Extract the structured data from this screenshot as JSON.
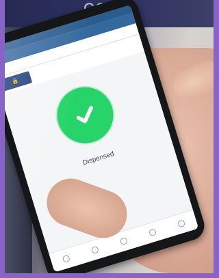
{
  "scene": {
    "background_wall_text": "CONE",
    "colors": {
      "frame_purple": "#8a63c9",
      "success_green": "#26d46a",
      "app_blue": "#34699e"
    }
  },
  "phone": {
    "status_bar": {
      "left": "",
      "right": ""
    },
    "app_bar": {
      "title": ""
    },
    "url_bar": {
      "text": ""
    },
    "banner": {
      "logo_icon": "lock-icon",
      "logo_text": ""
    },
    "result": {
      "icon": "checkmark-icon",
      "status_text": "Dispensed"
    },
    "bottom_nav": {
      "items": [
        {
          "icon": "circle-icon",
          "label": ""
        },
        {
          "icon": "circle-icon",
          "label": ""
        },
        {
          "icon": "circle-icon",
          "label": ""
        },
        {
          "icon": "circle-icon",
          "label": ""
        },
        {
          "icon": "circle-icon",
          "label": ""
        }
      ]
    }
  }
}
